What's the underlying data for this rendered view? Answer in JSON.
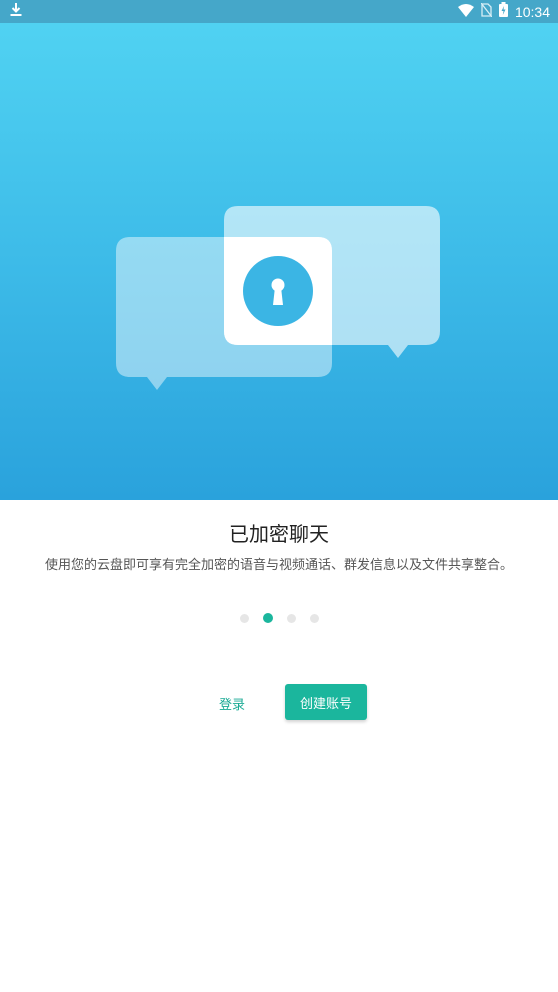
{
  "status_bar": {
    "time": "10:34",
    "icons": [
      "download-icon",
      "wifi-icon",
      "no-sim-icon",
      "battery-charging-icon"
    ]
  },
  "hero": {
    "illustration": "encrypted-chat-bubbles",
    "icons": [
      "chat-bubble-icon",
      "lock-icon"
    ],
    "gradient_top": "#50d2f2",
    "gradient_bottom": "#2aa2dc"
  },
  "onboarding": {
    "title": "已加密聊天",
    "description": "使用您的云盘即可享有完全加密的语音与视频通话、群发信息以及文件共享整合。",
    "page_indicator": {
      "total": 4,
      "current": 2
    }
  },
  "actions": {
    "login_label": "登录",
    "create_account_label": "创建账号"
  },
  "colors": {
    "accent": "#1bb69d",
    "status_bar": "#45a7c9"
  }
}
